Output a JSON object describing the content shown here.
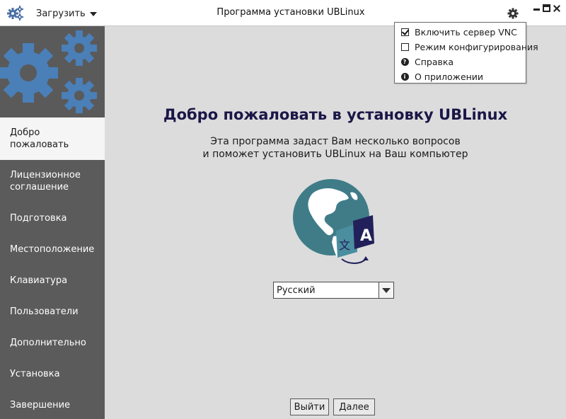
{
  "titlebar": {
    "title": "Программа установки UBLinux",
    "load_menu_label": "Загрузить",
    "app_icon": "gears-icon",
    "settings_icon": "gear-icon"
  },
  "popup_menu": {
    "items": [
      {
        "label": "Включить сервер VNC",
        "icon": "checkbox-checked-icon"
      },
      {
        "label": "Режим конфигурирования",
        "icon": "checkbox-unchecked-icon"
      },
      {
        "label": "Справка",
        "icon": "help-icon"
      },
      {
        "label": "О приложении",
        "icon": "info-icon"
      }
    ]
  },
  "sidebar": {
    "items": [
      {
        "label": "Добро\nпожаловать",
        "active": true
      },
      {
        "label": "Лицензионное\nсоглашение"
      },
      {
        "label": "Подготовка"
      },
      {
        "label": "Местоположение"
      },
      {
        "label": "Клавиатура"
      },
      {
        "label": "Пользователи"
      },
      {
        "label": "Дополнительно"
      },
      {
        "label": "Установка"
      },
      {
        "label": "Завершение"
      }
    ]
  },
  "main": {
    "title": "Добро пожаловать в установку UBLinux",
    "subtitle_line1": "Эта программа задаст Вам несколько вопросов",
    "subtitle_line2": "и поможет установить UBLinux на Ваш компьютер",
    "language_select": {
      "value": "Русский"
    },
    "exit_button": "Выйти",
    "next_button": "Далее"
  },
  "colors": {
    "sidebar_bg": "#5b5b5b",
    "main_bg": "#dcdcdc",
    "title_color": "#1a1747",
    "logo_blue": "#4a7fb8",
    "globe_teal": "#3f7c88"
  }
}
